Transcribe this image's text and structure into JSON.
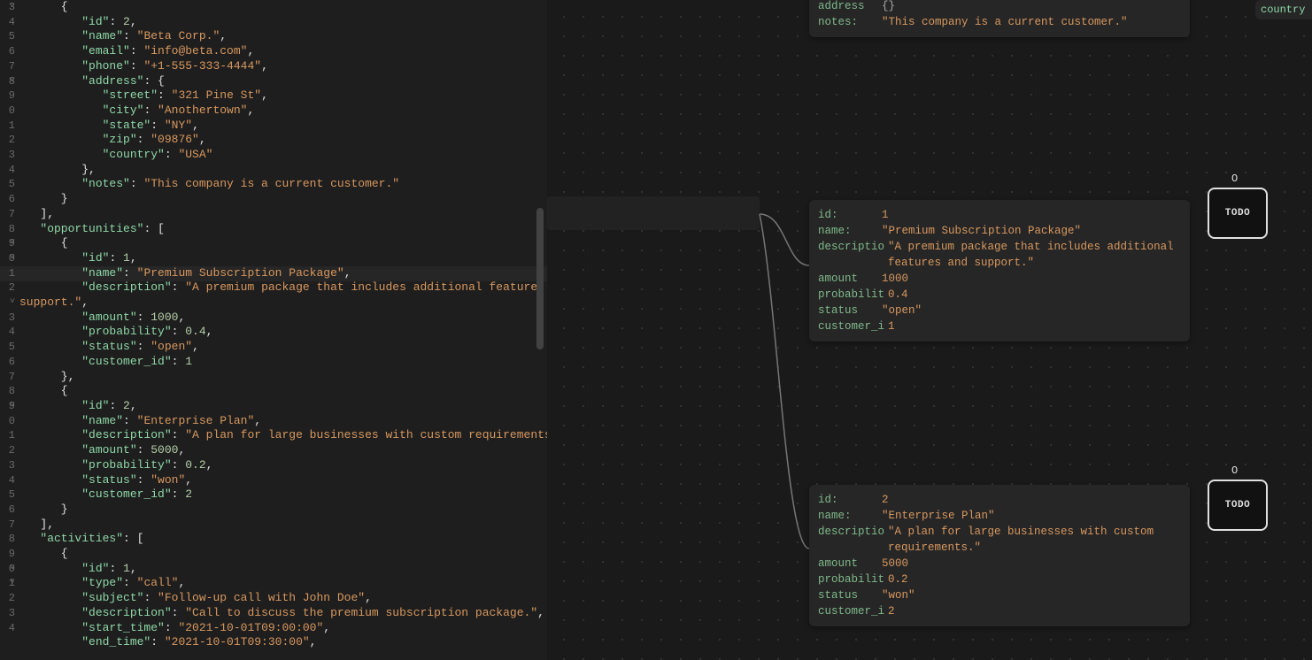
{
  "editor": {
    "highlighted_line_index": 18,
    "gutter": [
      "3",
      "4",
      "5",
      "6",
      "7",
      "8",
      "9",
      "0",
      "1",
      "2",
      "3",
      "4",
      "5",
      "6",
      "7",
      "8",
      "9",
      "0",
      "1",
      "2",
      "",
      "3",
      "4",
      "5",
      "6",
      "7",
      "8",
      "9",
      "0",
      "1",
      "2",
      "3",
      "4",
      "5",
      "6",
      "7",
      "8",
      "9",
      "0",
      "1",
      "2",
      "3",
      "4"
    ],
    "fold": [
      "˅",
      "",
      "",
      "",
      "",
      "˅",
      "",
      "",
      "",
      "",
      "",
      "",
      "",
      "",
      "",
      "",
      "˅",
      "˅",
      "",
      "",
      "˅",
      "",
      "",
      "",
      "",
      "",
      "",
      "˅",
      "",
      "",
      "",
      "",
      "",
      "",
      "",
      "",
      "",
      "",
      "˅",
      "˅",
      "",
      "",
      "",
      ""
    ],
    "lines": [
      [
        {
          "t": "      {",
          "c": "p"
        }
      ],
      [
        {
          "t": "         ",
          "c": "p"
        },
        {
          "t": "\"id\"",
          "c": "k"
        },
        {
          "t": ": ",
          "c": "p"
        },
        {
          "t": "2",
          "c": "n"
        },
        {
          "t": ",",
          "c": "p"
        }
      ],
      [
        {
          "t": "         ",
          "c": "p"
        },
        {
          "t": "\"name\"",
          "c": "k"
        },
        {
          "t": ": ",
          "c": "p"
        },
        {
          "t": "\"Beta Corp.\"",
          "c": "s"
        },
        {
          "t": ",",
          "c": "p"
        }
      ],
      [
        {
          "t": "         ",
          "c": "p"
        },
        {
          "t": "\"email\"",
          "c": "k"
        },
        {
          "t": ": ",
          "c": "p"
        },
        {
          "t": "\"info@beta.com\"",
          "c": "s"
        },
        {
          "t": ",",
          "c": "p"
        }
      ],
      [
        {
          "t": "         ",
          "c": "p"
        },
        {
          "t": "\"phone\"",
          "c": "k"
        },
        {
          "t": ": ",
          "c": "p"
        },
        {
          "t": "\"+1-555-333-4444\"",
          "c": "s"
        },
        {
          "t": ",",
          "c": "p"
        }
      ],
      [
        {
          "t": "         ",
          "c": "p"
        },
        {
          "t": "\"address\"",
          "c": "k"
        },
        {
          "t": ": {",
          "c": "p"
        }
      ],
      [
        {
          "t": "            ",
          "c": "p"
        },
        {
          "t": "\"street\"",
          "c": "k"
        },
        {
          "t": ": ",
          "c": "p"
        },
        {
          "t": "\"321 Pine St\"",
          "c": "s"
        },
        {
          "t": ",",
          "c": "p"
        }
      ],
      [
        {
          "t": "            ",
          "c": "p"
        },
        {
          "t": "\"city\"",
          "c": "k"
        },
        {
          "t": ": ",
          "c": "p"
        },
        {
          "t": "\"Anothertown\"",
          "c": "s"
        },
        {
          "t": ",",
          "c": "p"
        }
      ],
      [
        {
          "t": "            ",
          "c": "p"
        },
        {
          "t": "\"state\"",
          "c": "k"
        },
        {
          "t": ": ",
          "c": "p"
        },
        {
          "t": "\"NY\"",
          "c": "s"
        },
        {
          "t": ",",
          "c": "p"
        }
      ],
      [
        {
          "t": "            ",
          "c": "p"
        },
        {
          "t": "\"zip\"",
          "c": "k"
        },
        {
          "t": ": ",
          "c": "p"
        },
        {
          "t": "\"09876\"",
          "c": "s"
        },
        {
          "t": ",",
          "c": "p"
        }
      ],
      [
        {
          "t": "            ",
          "c": "p"
        },
        {
          "t": "\"country\"",
          "c": "k"
        },
        {
          "t": ": ",
          "c": "p"
        },
        {
          "t": "\"USA\"",
          "c": "s"
        }
      ],
      [
        {
          "t": "         },",
          "c": "p"
        }
      ],
      [
        {
          "t": "         ",
          "c": "p"
        },
        {
          "t": "\"notes\"",
          "c": "k"
        },
        {
          "t": ": ",
          "c": "p"
        },
        {
          "t": "\"This company is a current customer.\"",
          "c": "s"
        }
      ],
      [
        {
          "t": "      }",
          "c": "p"
        }
      ],
      [
        {
          "t": "   ],",
          "c": "p"
        }
      ],
      [
        {
          "t": "   ",
          "c": "p"
        },
        {
          "t": "\"opportunities\"",
          "c": "k"
        },
        {
          "t": ": [",
          "c": "p"
        }
      ],
      [
        {
          "t": "      {",
          "c": "p"
        }
      ],
      [
        {
          "t": "         ",
          "c": "p"
        },
        {
          "t": "\"id\"",
          "c": "k"
        },
        {
          "t": ": ",
          "c": "p"
        },
        {
          "t": "1",
          "c": "n"
        },
        {
          "t": ",",
          "c": "p"
        }
      ],
      [
        {
          "t": "         ",
          "c": "p"
        },
        {
          "t": "\"name\"",
          "c": "k"
        },
        {
          "t": ": ",
          "c": "p"
        },
        {
          "t": "\"Premium Subscription Package\"",
          "c": "s"
        },
        {
          "t": ",",
          "c": "p"
        }
      ],
      [
        {
          "t": "         ",
          "c": "p"
        },
        {
          "t": "\"description\"",
          "c": "k"
        },
        {
          "t": ": ",
          "c": "p"
        },
        {
          "t": "\"A premium package that includes additional features and ",
          "c": "s"
        }
      ],
      [
        {
          "t": "support.\"",
          "c": "s"
        },
        {
          "t": ",",
          "c": "p"
        }
      ],
      [
        {
          "t": "         ",
          "c": "p"
        },
        {
          "t": "\"amount\"",
          "c": "k"
        },
        {
          "t": ": ",
          "c": "p"
        },
        {
          "t": "1000",
          "c": "n"
        },
        {
          "t": ",",
          "c": "p"
        }
      ],
      [
        {
          "t": "         ",
          "c": "p"
        },
        {
          "t": "\"probability\"",
          "c": "k"
        },
        {
          "t": ": ",
          "c": "p"
        },
        {
          "t": "0.4",
          "c": "n"
        },
        {
          "t": ",",
          "c": "p"
        }
      ],
      [
        {
          "t": "         ",
          "c": "p"
        },
        {
          "t": "\"status\"",
          "c": "k"
        },
        {
          "t": ": ",
          "c": "p"
        },
        {
          "t": "\"open\"",
          "c": "s"
        },
        {
          "t": ",",
          "c": "p"
        }
      ],
      [
        {
          "t": "         ",
          "c": "p"
        },
        {
          "t": "\"customer_id\"",
          "c": "k"
        },
        {
          "t": ": ",
          "c": "p"
        },
        {
          "t": "1",
          "c": "n"
        }
      ],
      [
        {
          "t": "      },",
          "c": "p"
        }
      ],
      [
        {
          "t": "      {",
          "c": "p"
        }
      ],
      [
        {
          "t": "         ",
          "c": "p"
        },
        {
          "t": "\"id\"",
          "c": "k"
        },
        {
          "t": ": ",
          "c": "p"
        },
        {
          "t": "2",
          "c": "n"
        },
        {
          "t": ",",
          "c": "p"
        }
      ],
      [
        {
          "t": "         ",
          "c": "p"
        },
        {
          "t": "\"name\"",
          "c": "k"
        },
        {
          "t": ": ",
          "c": "p"
        },
        {
          "t": "\"Enterprise Plan\"",
          "c": "s"
        },
        {
          "t": ",",
          "c": "p"
        }
      ],
      [
        {
          "t": "         ",
          "c": "p"
        },
        {
          "t": "\"description\"",
          "c": "k"
        },
        {
          "t": ": ",
          "c": "p"
        },
        {
          "t": "\"A plan for large businesses with custom requirements.\"",
          "c": "s"
        },
        {
          "t": ",",
          "c": "p"
        }
      ],
      [
        {
          "t": "         ",
          "c": "p"
        },
        {
          "t": "\"amount\"",
          "c": "k"
        },
        {
          "t": ": ",
          "c": "p"
        },
        {
          "t": "5000",
          "c": "n"
        },
        {
          "t": ",",
          "c": "p"
        }
      ],
      [
        {
          "t": "         ",
          "c": "p"
        },
        {
          "t": "\"probability\"",
          "c": "k"
        },
        {
          "t": ": ",
          "c": "p"
        },
        {
          "t": "0.2",
          "c": "n"
        },
        {
          "t": ",",
          "c": "p"
        }
      ],
      [
        {
          "t": "         ",
          "c": "p"
        },
        {
          "t": "\"status\"",
          "c": "k"
        },
        {
          "t": ": ",
          "c": "p"
        },
        {
          "t": "\"won\"",
          "c": "s"
        },
        {
          "t": ",",
          "c": "p"
        }
      ],
      [
        {
          "t": "         ",
          "c": "p"
        },
        {
          "t": "\"customer_id\"",
          "c": "k"
        },
        {
          "t": ": ",
          "c": "p"
        },
        {
          "t": "2",
          "c": "n"
        }
      ],
      [
        {
          "t": "      }",
          "c": "p"
        }
      ],
      [
        {
          "t": "   ],",
          "c": "p"
        }
      ],
      [
        {
          "t": "   ",
          "c": "p"
        },
        {
          "t": "\"activities\"",
          "c": "k"
        },
        {
          "t": ": [",
          "c": "p"
        }
      ],
      [
        {
          "t": "      {",
          "c": "p"
        }
      ],
      [
        {
          "t": "         ",
          "c": "p"
        },
        {
          "t": "\"id\"",
          "c": "k"
        },
        {
          "t": ": ",
          "c": "p"
        },
        {
          "t": "1",
          "c": "n"
        },
        {
          "t": ",",
          "c": "p"
        }
      ],
      [
        {
          "t": "         ",
          "c": "p"
        },
        {
          "t": "\"type\"",
          "c": "k"
        },
        {
          "t": ": ",
          "c": "p"
        },
        {
          "t": "\"call\"",
          "c": "s"
        },
        {
          "t": ",",
          "c": "p"
        }
      ],
      [
        {
          "t": "         ",
          "c": "p"
        },
        {
          "t": "\"subject\"",
          "c": "k"
        },
        {
          "t": ": ",
          "c": "p"
        },
        {
          "t": "\"Follow-up call with John Doe\"",
          "c": "s"
        },
        {
          "t": ",",
          "c": "p"
        }
      ],
      [
        {
          "t": "         ",
          "c": "p"
        },
        {
          "t": "\"description\"",
          "c": "k"
        },
        {
          "t": ": ",
          "c": "p"
        },
        {
          "t": "\"Call to discuss the premium subscription package.\"",
          "c": "s"
        },
        {
          "t": ",",
          "c": "p"
        }
      ],
      [
        {
          "t": "         ",
          "c": "p"
        },
        {
          "t": "\"start_time\"",
          "c": "k"
        },
        {
          "t": ": ",
          "c": "p"
        },
        {
          "t": "\"2021-10-01T09:00:00\"",
          "c": "s"
        },
        {
          "t": ",",
          "c": "p"
        }
      ],
      [
        {
          "t": "         ",
          "c": "p"
        },
        {
          "t": "\"end_time\"",
          "c": "k"
        },
        {
          "t": ": ",
          "c": "p"
        },
        {
          "t": "\"2021-10-01T09:30:00\"",
          "c": "s"
        },
        {
          "t": ",",
          "c": "p"
        }
      ]
    ]
  },
  "canvas": {
    "top_node": {
      "address_key": "address",
      "address_val": "{}",
      "notes_key": "notes:",
      "notes_val": "\"This company is a current customer.\"",
      "country_key": "country",
      "country_quote": "\""
    },
    "node1": {
      "rows": [
        {
          "k": "id:",
          "v": "1",
          "t": "num"
        },
        {
          "k": "name:",
          "v": "\"Premium Subscription Package\"",
          "t": "str"
        },
        {
          "k": "descriptio",
          "v": "\"A premium package that includes additional features and support.\"",
          "t": "str"
        },
        {
          "k": "amount",
          "v": "1000",
          "t": "num"
        },
        {
          "k": "probabilit",
          "v": "0.4",
          "t": "num"
        },
        {
          "k": "status",
          "v": "\"open\"",
          "t": "str"
        },
        {
          "k": "customer_i",
          "v": "1",
          "t": "num"
        }
      ]
    },
    "node2": {
      "rows": [
        {
          "k": "id:",
          "v": "2",
          "t": "num"
        },
        {
          "k": "name:",
          "v": "\"Enterprise Plan\"",
          "t": "str"
        },
        {
          "k": "descriptio",
          "v": "\"A plan for large businesses with custom requirements.\"",
          "t": "str"
        },
        {
          "k": "amount",
          "v": "5000",
          "t": "num"
        },
        {
          "k": "probabilit",
          "v": "0.2",
          "t": "num"
        },
        {
          "k": "status",
          "v": "\"won\"",
          "t": "str"
        },
        {
          "k": "customer_i",
          "v": "2",
          "t": "num"
        }
      ]
    },
    "badge_o": "O",
    "todo_label": "TODO"
  }
}
